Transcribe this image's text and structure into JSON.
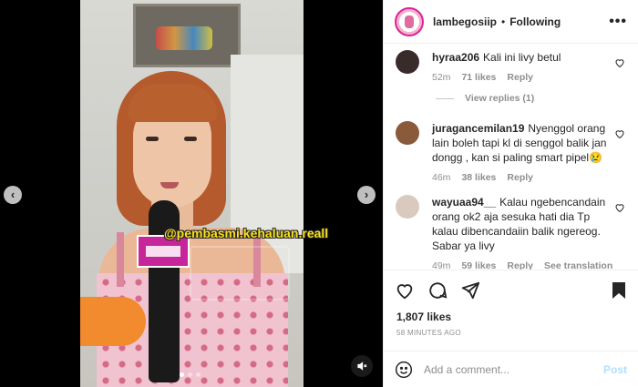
{
  "header": {
    "username": "lambegosiip",
    "separator": "•",
    "follow_status": "Following",
    "more_icon": "more-horizontal-icon"
  },
  "media": {
    "overlay_text": "@pembasmi.kehaluan.reall",
    "slide_count": 3,
    "current_slide": 1
  },
  "comments": [
    {
      "username": "hyraa206",
      "text": "Kali ini livy betul",
      "time": "52m",
      "likes": "71 likes",
      "reply": "Reply",
      "avatar_color": "#3a2b2b"
    },
    {
      "username": "juragancemilan19",
      "text": "Nyenggol orang lain boleh tapi kl di senggol balik jan dongg , kan si paling smart pipel😢",
      "time": "46m",
      "likes": "38 likes",
      "reply": "Reply",
      "avatar_color": "#8a5a3a"
    },
    {
      "username": "wayuaa94__",
      "text": "Kalau ngebencandain orang ok2 aja sesuka hati dia Tp kalau dibencandaiin balik ngereog. Sabar ya livy",
      "time": "49m",
      "likes": "59 likes",
      "reply": "Reply",
      "translate": "See translation",
      "avatar_color": "#d9c9bf"
    }
  ],
  "view_replies": "View replies (1)",
  "footer": {
    "likes": "1,807 likes",
    "time_ago": "58 MINUTES AGO",
    "comment_placeholder": "Add a comment...",
    "post_label": "Post"
  },
  "colors": {
    "accent": "#0095f6",
    "post_disabled": "#b2dffc",
    "muted_text": "#8e8e8e",
    "overlay_text": "#f7e11e"
  }
}
